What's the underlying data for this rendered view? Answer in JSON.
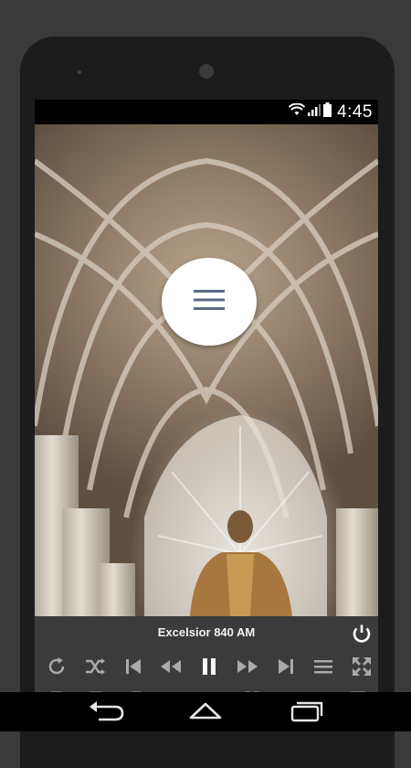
{
  "status_bar": {
    "time": "4:45",
    "icons": [
      "wifi-icon",
      "signal-icon",
      "battery-icon"
    ]
  },
  "hero": {
    "image": "cathedral-arches-with-jesus-statue"
  },
  "menu_button": {
    "icon": "hamburger-menu-icon"
  },
  "player": {
    "station_name": "Excelsior 840 AM",
    "controls": [
      "repeat-icon",
      "shuffle-icon",
      "skip-previous-icon",
      "rewind-icon",
      "pause-icon",
      "fast-forward-icon",
      "skip-next-icon",
      "playlist-icon",
      "fullscreen-icon"
    ]
  },
  "navigation": [
    "back-icon",
    "home-icon",
    "recents-icon"
  ],
  "colors": {
    "player_bg": "#3b3b3b",
    "menu_icon": "#5b6b82"
  }
}
